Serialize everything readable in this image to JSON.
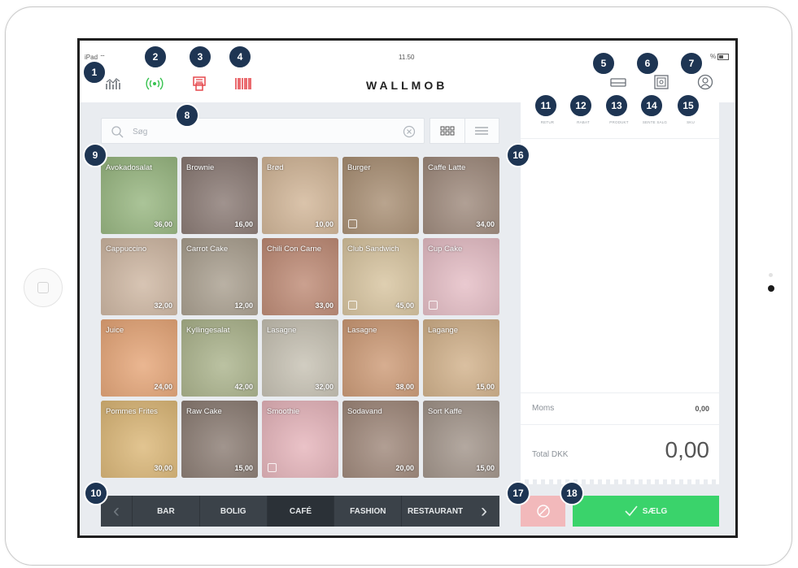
{
  "status": {
    "carrier": "iPad",
    "time": "11.50",
    "battery": "%"
  },
  "header": {
    "logo": "WALLMOB"
  },
  "search": {
    "placeholder": "Søg"
  },
  "products": [
    {
      "name": "Avokadosalat",
      "price": "36,00",
      "color": "#5f8f3b",
      "info": false
    },
    {
      "name": "Brownie",
      "price": "16,00",
      "color": "#4a3128",
      "info": false
    },
    {
      "name": "Brød",
      "price": "10,00",
      "color": "#b98e5f",
      "info": false
    },
    {
      "name": "Burger",
      "price": "",
      "color": "#7a5228",
      "info": true
    },
    {
      "name": "Caffe Latte",
      "price": "34,00",
      "color": "#6a4a35",
      "info": false
    },
    {
      "name": "Cappuccino",
      "price": "32,00",
      "color": "#b49070",
      "info": false
    },
    {
      "name": "Carrot Cake",
      "price": "12,00",
      "color": "#7b6b52",
      "info": false
    },
    {
      "name": "Chili Con Carne",
      "price": "33,00",
      "color": "#9b4b2a",
      "info": false
    },
    {
      "name": "Club Sandwich",
      "price": "45,00",
      "color": "#c2a46b",
      "info": true
    },
    {
      "name": "Cup Cake",
      "price": "",
      "color": "#d79aa6",
      "info": true
    },
    {
      "name": "Juice",
      "price": "24,00",
      "color": "#d8752e",
      "info": false
    },
    {
      "name": "Kyllingesalat",
      "price": "42,00",
      "color": "#7e8b4e",
      "info": false
    },
    {
      "name": "Lasagne",
      "price": "32,00",
      "color": "#a8a08a",
      "info": false
    },
    {
      "name": "Lasagne",
      "price": "38,00",
      "color": "#b2642c",
      "info": false
    },
    {
      "name": "Lagange",
      "price": "15,00",
      "color": "#b9874b",
      "info": false
    },
    {
      "name": "Pommes Frites",
      "price": "30,00",
      "color": "#c8902d",
      "info": false
    },
    {
      "name": "Raw Cake",
      "price": "15,00",
      "color": "#4c3527",
      "info": false
    },
    {
      "name": "Smoothie",
      "price": "",
      "color": "#d88c96",
      "info": true
    },
    {
      "name": "Sodavand",
      "price": "20,00",
      "color": "#6b4732",
      "info": false
    },
    {
      "name": "Sort Kaffe",
      "price": "15,00",
      "color": "#6f5a4a",
      "info": false
    }
  ],
  "categories": [
    {
      "label": "BAR",
      "active": false
    },
    {
      "label": "BOLIG",
      "active": false
    },
    {
      "label": "CAFÉ",
      "active": true
    },
    {
      "label": "FASHION",
      "active": false
    },
    {
      "label": "RESTAURANT",
      "active": false
    }
  ],
  "functions": [
    {
      "label": "RETUR"
    },
    {
      "label": "RABAT"
    },
    {
      "label": "PRODUKT"
    },
    {
      "label": "SENTE SALG"
    },
    {
      "label": "SKU"
    }
  ],
  "totals": {
    "moms_label": "Moms",
    "moms_value": "0,00",
    "total_label": "Total DKK",
    "total_value": "0,00"
  },
  "actions": {
    "sell_label": "SÆLG"
  },
  "badges": [
    "1",
    "2",
    "3",
    "4",
    "5",
    "6",
    "7",
    "8",
    "9",
    "10",
    "11",
    "12",
    "13",
    "14",
    "15",
    "16",
    "17",
    "18"
  ],
  "colors": {
    "badge": "#1e3553",
    "sell": "#3ad36b",
    "cancel": "#f2b9bb",
    "category_bar": "#3b4249",
    "accent_red": "#e5484d",
    "accent_green": "#37c24f"
  }
}
